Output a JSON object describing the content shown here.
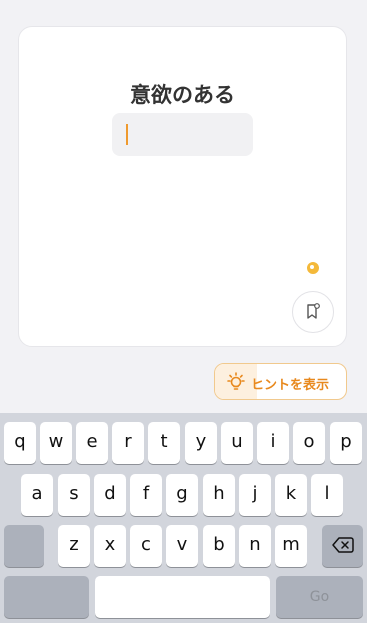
{
  "card": {
    "word": "意欲のある",
    "answer_value": ""
  },
  "icons": {
    "bookmark": "bookmark-icon",
    "badge": "gold-badge-icon",
    "hint": "lightbulb-icon",
    "delete": "backspace-icon"
  },
  "hint": {
    "label": "ヒントを表示"
  },
  "keyboard": {
    "row1": [
      "q",
      "w",
      "e",
      "r",
      "t",
      "y",
      "u",
      "i",
      "o",
      "p"
    ],
    "row2": [
      "a",
      "s",
      "d",
      "f",
      "g",
      "h",
      "j",
      "k",
      "l"
    ],
    "row3": [
      "z",
      "x",
      "c",
      "v",
      "b",
      "n",
      "m"
    ],
    "go_label": "Go"
  },
  "colors": {
    "accent": "#e8891e",
    "caret": "#ef9a2e",
    "badge": "#f4b93a",
    "keyboard_bg": "#d2d5dc"
  }
}
